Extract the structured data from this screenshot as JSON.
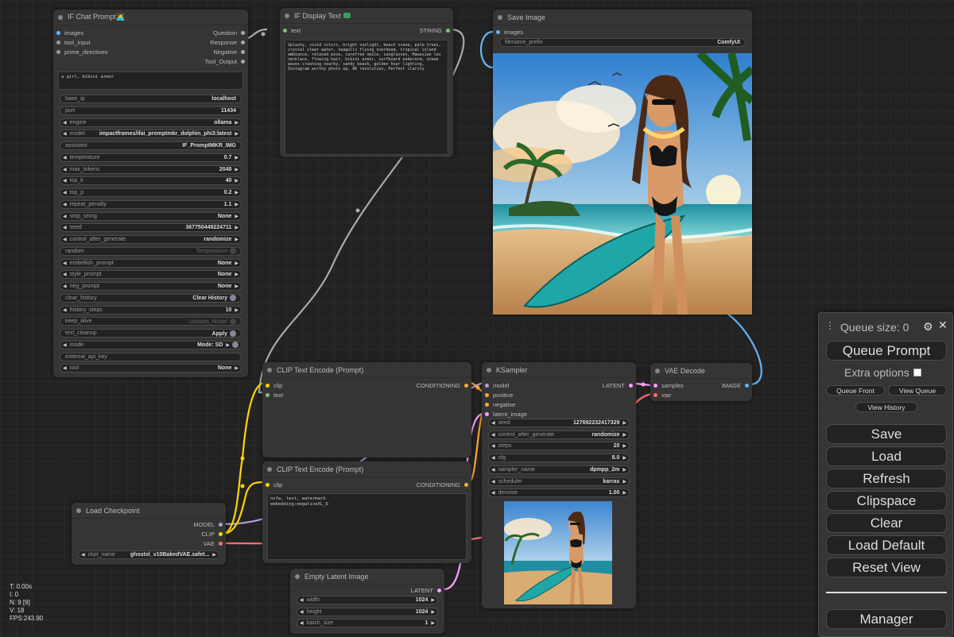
{
  "colors": {
    "canvas_bg": "#222222",
    "node_bg": "#353535",
    "link_image": "#64b5f6",
    "link_conditioning": "#ffa931",
    "link_clip": "#ffd500",
    "link_latent": "#ff9cf9",
    "link_vae": "#ff6e6e",
    "link_string": "#aaaaaa"
  },
  "chat_prompt": {
    "title": "IF Chat Prompt🧑‍💻",
    "inputs": [
      "images",
      "tool_input",
      "prime_directives"
    ],
    "outputs": [
      "Question",
      "Response",
      "Negative",
      "Tool_Output"
    ],
    "prompt_text": "a girl, bikini armor",
    "widgets": [
      {
        "label": "base_ip",
        "value": "localhost"
      },
      {
        "label": "port",
        "value": "11434"
      },
      {
        "label": "engine",
        "value": "ollama"
      },
      {
        "label": "model",
        "value": "impactframes/ifai_promptmkr_dolphin_phi3:latest"
      },
      {
        "label": "assistant",
        "value": "IF_PromptMKR_IMG"
      },
      {
        "label": "temperature",
        "value": "0.7"
      },
      {
        "label": "max_tokens",
        "value": "2048"
      },
      {
        "label": "top_k",
        "value": "40"
      },
      {
        "label": "top_p",
        "value": "0.2"
      },
      {
        "label": "repeat_penalty",
        "value": "1.1"
      },
      {
        "label": "stop_string",
        "value": "None"
      },
      {
        "label": "seed",
        "value": "367750449224711"
      },
      {
        "label": "control_after_generate",
        "value": "randomize"
      },
      {
        "label": "random",
        "value": "Temperature"
      },
      {
        "label": "embellish_prompt",
        "value": "None"
      },
      {
        "label": "style_prompt",
        "value": "None"
      },
      {
        "label": "neg_prompt",
        "value": "None"
      },
      {
        "label": "clear_history",
        "value": "Clear History"
      },
      {
        "label": "history_steps",
        "value": "10"
      },
      {
        "label": "keep_alive",
        "value": "Unloads_Model"
      },
      {
        "label": "text_cleanup",
        "value": "Apply"
      },
      {
        "label": "mode",
        "value": "Mode: SD"
      },
      {
        "label": "external_api_key",
        "value": ""
      },
      {
        "label": "tool",
        "value": "None"
      }
    ]
  },
  "display_text": {
    "title": "IF Display Text",
    "input": "text",
    "output": "STRING",
    "content": "Splashy, vivid colors, bright sunlight, beach scene, palm trees, crystal clear water, seagulls flying overhead, tropical island ambiance, relaxed pose, carefree smile, sunglasses, Hawaiian lei necklace, flowing hair, bikini armor, surfboard underarm, ocean waves crashing nearby, sandy beach, golden hour lighting, Instagram worthy photo op, 8K resolution, Perfect clarity"
  },
  "save_image": {
    "title": "Save Image",
    "input": "images",
    "filename_label": "filename_prefix",
    "filename_value": "ComfyUI"
  },
  "clip_pos": {
    "title": "CLIP Text Encode (Prompt)",
    "inputs": [
      "clip",
      "text"
    ],
    "output": "CONDITIONING"
  },
  "clip_neg": {
    "title": "CLIP Text Encode (Prompt)",
    "input": "clip",
    "output": "CONDITIONING",
    "text": "nsfw, text, watermark\nembedding:negativeXL_D"
  },
  "ksampler": {
    "title": "KSampler",
    "inputs": [
      "model",
      "positive",
      "negative",
      "latent_image"
    ],
    "output": "LATENT",
    "widgets": [
      {
        "label": "seed",
        "value": "127692232417329"
      },
      {
        "label": "control_after_generate",
        "value": "randomize"
      },
      {
        "label": "steps",
        "value": "20"
      },
      {
        "label": "cfg",
        "value": "8.0"
      },
      {
        "label": "sampler_name",
        "value": "dpmpp_2m"
      },
      {
        "label": "scheduler",
        "value": "karras"
      },
      {
        "label": "denoise",
        "value": "1.00"
      }
    ]
  },
  "vae_decode": {
    "title": "VAE Decode",
    "inputs": [
      "samples",
      "vae"
    ],
    "output": "IMAGE"
  },
  "load_checkpoint": {
    "title": "Load Checkpoint",
    "outputs": [
      "MODEL",
      "CLIP",
      "VAE"
    ],
    "ckpt_label": "ckpt_name",
    "ckpt_value": "ghostxl_v10BakedVAE.safet..."
  },
  "empty_latent": {
    "title": "Empty Latent Image",
    "output": "LATENT",
    "widgets": [
      {
        "label": "width",
        "value": "1024"
      },
      {
        "label": "height",
        "value": "1024"
      },
      {
        "label": "batch_size",
        "value": "1"
      }
    ]
  },
  "queue": {
    "size_label": "Queue size: 0",
    "queue_prompt": "Queue Prompt",
    "extra_options": "Extra options",
    "queue_front": "Queue Front",
    "view_queue": "View Queue",
    "view_history": "View History",
    "save": "Save",
    "load": "Load",
    "refresh": "Refresh",
    "clipspace": "Clipspace",
    "clear": "Clear",
    "load_default": "Load Default",
    "reset_view": "Reset View",
    "manager": "Manager"
  },
  "stats": {
    "t": "T: 0.00s",
    "i": "I: 0",
    "n": "N: 9 [9]",
    "v": "V: 18",
    "fps": "FPS:243.90"
  }
}
